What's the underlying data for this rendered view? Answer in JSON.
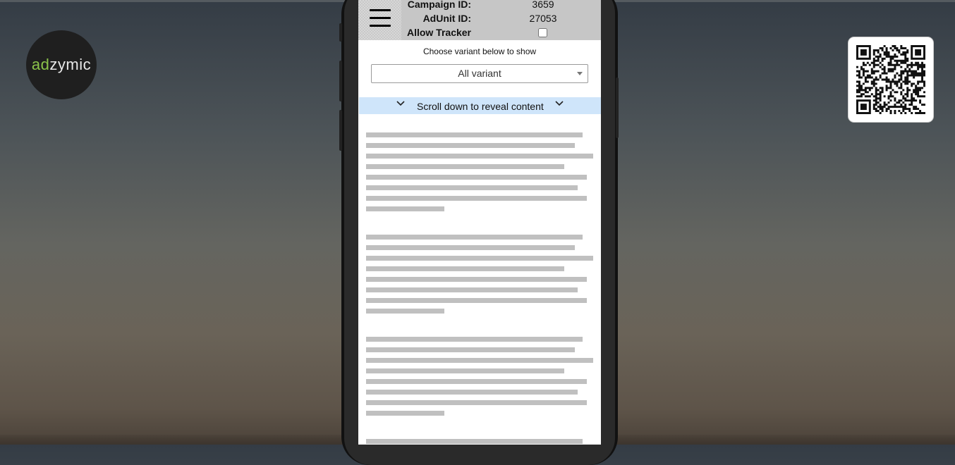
{
  "logo": {
    "prefix": "ad",
    "suffix": "zymic"
  },
  "qr": {
    "icon": "qr-code-icon"
  },
  "header": {
    "campaign_label": "Campaign ID:",
    "campaign_value": "3659",
    "adunit_label": "AdUnit ID:",
    "adunit_value": "27053",
    "tracker_label": "Allow Tracker",
    "tracker_checked": false
  },
  "variant": {
    "prompt": "Choose variant below to show",
    "selected": "All variant"
  },
  "banner": {
    "text": "Scroll down to reveal content"
  },
  "colors": {
    "accent_green": "#8bc34a",
    "banner_bg": "#cfe5fa",
    "header_bg": "#c6c6c6",
    "placeholder_line": "#c0c0c0"
  }
}
